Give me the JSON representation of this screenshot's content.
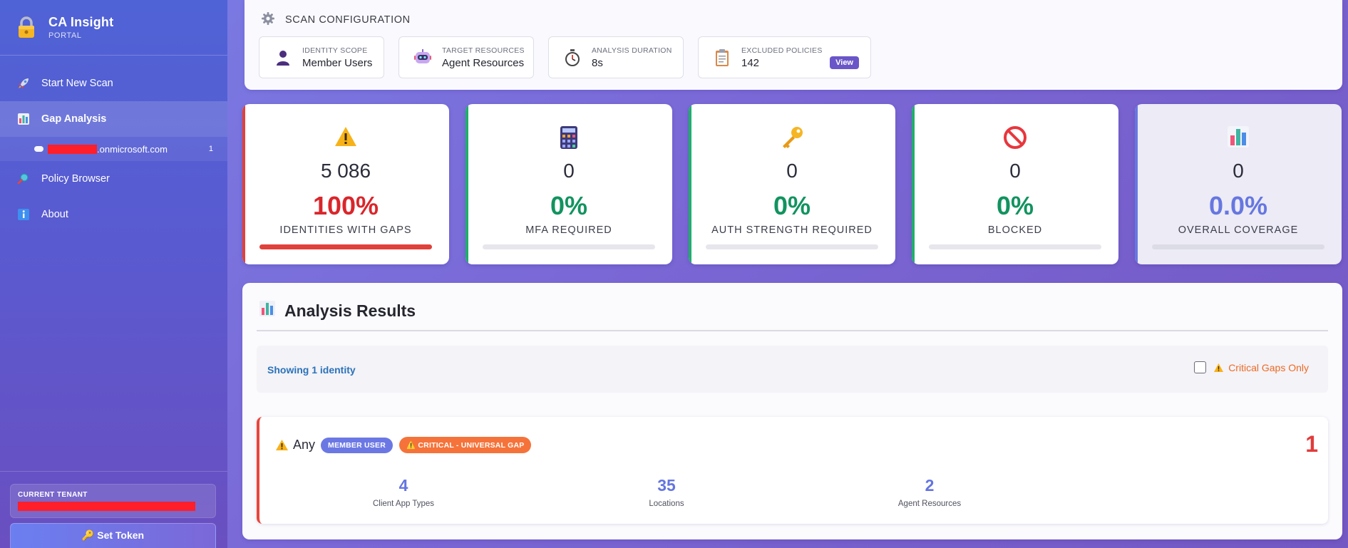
{
  "app": {
    "title": "CA Insight",
    "subtitle": "PORTAL"
  },
  "sidebar": {
    "items": [
      {
        "label": "Start New Scan",
        "icon": "rocket-icon"
      },
      {
        "label": "Gap Analysis",
        "icon": "bar-chart-icon"
      },
      {
        "label": "Policy Browser",
        "icon": "magnifier-icon"
      },
      {
        "label": "About",
        "icon": "info-icon"
      }
    ],
    "sub_item": {
      "domain_suffix": ".onmicrosoft.com",
      "count": "1"
    },
    "tenant_label": "CURRENT TENANT",
    "set_token_label": "🔑 Set Token"
  },
  "config": {
    "title": "SCAN CONFIGURATION",
    "cards": [
      {
        "label": "IDENTITY SCOPE",
        "value": "Member Users",
        "icon": "user-icon"
      },
      {
        "label": "TARGET RESOURCES",
        "value": "Agent Resources",
        "icon": "robot-icon"
      },
      {
        "label": "ANALYSIS DURATION",
        "value": "8s",
        "icon": "stopwatch-icon"
      },
      {
        "label": "EXCLUDED POLICIES",
        "value": "142",
        "icon": "clipboard-icon"
      }
    ],
    "view_label": "View"
  },
  "stats": [
    {
      "count": "5 086",
      "pct": "100%",
      "label": "IDENTITIES WITH GAPS",
      "icon": "warning-icon",
      "color": "#d9262b",
      "fill": 1.0
    },
    {
      "count": "0",
      "pct": "0%",
      "label": "MFA REQUIRED",
      "icon": "calculator-icon",
      "color": "#12935f",
      "fill": 0
    },
    {
      "count": "0",
      "pct": "0%",
      "label": "AUTH STRENGTH REQUIRED",
      "icon": "key-icon",
      "color": "#12935f",
      "fill": 0
    },
    {
      "count": "0",
      "pct": "0%",
      "label": "BLOCKED",
      "icon": "prohibited-icon",
      "color": "#12935f",
      "fill": 0
    },
    {
      "count": "0",
      "pct": "0.0%",
      "label": "OVERALL COVERAGE",
      "icon": "bar-chart-icon",
      "color": "#6677e0",
      "fill": 0
    }
  ],
  "results": {
    "title": "Analysis Results",
    "showing": "Showing 1 identity",
    "critical_filter_label": "Critical Gaps Only",
    "identity": {
      "name": "Any",
      "badge_member": "MEMBER USER",
      "badge_critical": "⚠️ CRITICAL - UNIVERSAL GAP",
      "gap_count": "1",
      "metrics": [
        {
          "value": "4",
          "label": "Client App Types"
        },
        {
          "value": "35",
          "label": "Locations"
        },
        {
          "value": "2",
          "label": "Agent Resources"
        }
      ]
    }
  },
  "colors": {
    "accent": "#6a56c8",
    "critical": "#e23b3b",
    "success": "#12935f",
    "link": "#2c72b8"
  }
}
